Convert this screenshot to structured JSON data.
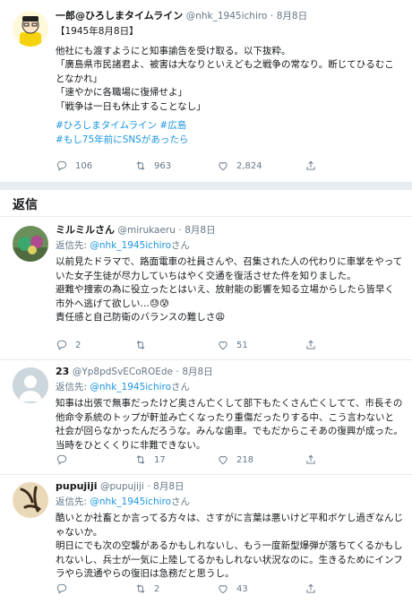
{
  "main_tweet": {
    "name": "一郎@ひろしまタイムライン",
    "handle": "@nhk_1945ichiro",
    "date": "8月8日",
    "lines": [
      "【1945年8月8日】",
      "",
      "他社にも渡すようにと知事諭告を受け取る。以下抜粋。",
      "「廣島県市民諸君よ、被害は大なりといえども之戦争の常なり。断じてひるむことなかれ」",
      "「速やかに各職場に復帰せよ」",
      "「戦争は一日も休止することなし」"
    ],
    "hashtags": [
      "#ひろしまタイムライン",
      "#広島",
      "#もし75年前にSNSがあったら"
    ],
    "replies": "106",
    "retweets": "963",
    "likes": "2,824"
  },
  "section": {
    "title": "返信"
  },
  "replies": [
    {
      "name": "ミルミルさん",
      "handle": "@mirukaeru",
      "date": "8月8日",
      "reply_prefix": "返信先: ",
      "reply_to": "@nhk_1945ichiro",
      "reply_suffix": "さん",
      "lines": [
        "以前見たドラマで、路面電車の社員さんや、召集された人の代わりに車掌をやっていた女子生徒が尽力していちはやく交通を復活させた件を知りました。",
        "避難や捜索の為に役立ったとはいえ、放射能の影響を知る立場からしたら皆早く市外へ逃げて欲しい…😓😰",
        "責任感と自己防衛のバランスの難しさ😩"
      ],
      "replies": "2",
      "retweets": "",
      "likes": "51"
    },
    {
      "name": "23",
      "handle": "@Yp8pdSvECoROEde",
      "date": "8月8日",
      "reply_prefix": "返信先: ",
      "reply_to": "@nhk_1945ichiro",
      "reply_suffix": "さん",
      "lines": [
        "知事は出張で無事だったけど奥さん亡くして部下もたくさん亡くしてて、市長その他命令系統のトップが軒並み亡くなったり重傷だったりする中、こう言わないと社会が回らなかったんだろうな。みんな歯車。でもだからこそあの復興が成った。当時をひとくくりに非難できない。"
      ],
      "replies": "",
      "retweets": "17",
      "likes": "218"
    },
    {
      "name": "pupujiji",
      "handle": "@pupujiji",
      "date": "8月8日",
      "reply_prefix": "返信先: ",
      "reply_to": "@nhk_1945ichiro",
      "reply_suffix": "さん",
      "lines": [
        "酷いとか社畜とか言ってる方々は、さすがに言葉は悪いけど平和ボケし過ぎなんじゃないか。",
        "明日にでも次の空襲があるかもしれないし、もう一度新型爆弾が落ちてくるかもしれないし、兵士が一気に上陸してるかもしれない状況なのに。生きるためにインフラやら流通やらの復旧は急務だと思うし。"
      ],
      "replies": "",
      "retweets": "2",
      "likes": "43"
    }
  ],
  "icons": {
    "reply": "reply-icon",
    "retweet": "retweet-icon",
    "like": "heart-icon",
    "share": "share-icon"
  },
  "colors": {
    "link": "#1b95e0",
    "muted": "#657786",
    "divider": "#e6ecf0"
  }
}
